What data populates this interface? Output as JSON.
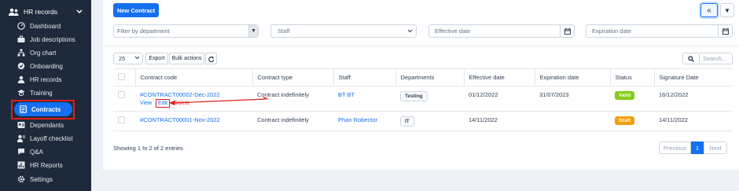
{
  "sidebar": {
    "header": {
      "label": "HR records",
      "icon": "users-icon"
    },
    "items": [
      {
        "label": "Dashboard",
        "icon": "dashboard-icon"
      },
      {
        "label": "Job descriptions",
        "icon": "briefcase-icon"
      },
      {
        "label": "Org chart",
        "icon": "org-chart-icon"
      },
      {
        "label": "Onboarding",
        "icon": "onboarding-icon"
      },
      {
        "label": "HR records",
        "icon": "user-icon"
      },
      {
        "label": "Training",
        "icon": "training-icon"
      },
      {
        "label": "Contracts",
        "icon": "contract-icon"
      },
      {
        "label": "Dependants",
        "icon": "dependants-icon"
      },
      {
        "label": "Layoff checklist",
        "icon": "checklist-icon"
      },
      {
        "label": "Q&A",
        "icon": "qa-icon"
      },
      {
        "label": "HR Reports",
        "icon": "reports-icon"
      },
      {
        "label": "Settings",
        "icon": "gear-icon"
      }
    ]
  },
  "toolbar": {
    "new_contract_label": "New Contract",
    "collapse_icon": "«",
    "filter_icon": "▼"
  },
  "filters": {
    "department_placeholder": "Filter by department",
    "staff_placeholder": "Staff",
    "effective_date_placeholder": "Effective date",
    "expiration_date_placeholder": "Expiration date"
  },
  "table_controls": {
    "page_size": "25",
    "export_label": "Export",
    "bulk_actions_label": "Bulk actions",
    "search_placeholder": "Search..."
  },
  "table": {
    "headers": [
      "Contract code",
      "Contract type",
      "Staff",
      "Departments",
      "Effective date",
      "Expiration date",
      "Status",
      "Signature Date"
    ],
    "rows": [
      {
        "code": "#CONTRACT00002-Dec-2022",
        "type": "Contract indefinitely",
        "staff": "BT BT",
        "department": "Testing",
        "effective": "01/12/2022",
        "expiration": "31/07/2023",
        "status": "Valid",
        "signature": "16/12/2022",
        "actions": {
          "view": "View",
          "edit": "Edit",
          "delete": "Delete"
        }
      },
      {
        "code": "#CONTRACT00001-Nov-2022",
        "type": "Contract indefinitely",
        "staff": "Phan Robector",
        "department": "IT",
        "effective": "14/11/2022",
        "expiration": "",
        "status": "Draft",
        "signature": "14/11/2022"
      }
    ]
  },
  "footer": {
    "showing": "Showing 1 to 2 of 2 entries",
    "previous": "Previous",
    "page": "1",
    "next": "Next"
  },
  "colors": {
    "sidebar_bg": "#1e2a3b",
    "primary": "#1570ef",
    "valid": "#84cc16",
    "draft": "#f59e0b",
    "annotation_red": "#e11d1d"
  }
}
